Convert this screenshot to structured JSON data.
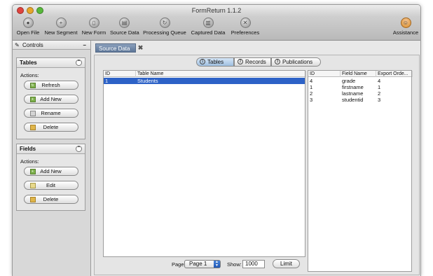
{
  "window": {
    "title": "FormReturn 1.1.2"
  },
  "toolbar": {
    "items": [
      {
        "label": "Open File",
        "icon": "open-file-icon"
      },
      {
        "label": "New Segment",
        "icon": "new-segment-icon"
      },
      {
        "label": "New Form",
        "icon": "new-form-icon"
      },
      {
        "label": "Source Data",
        "icon": "source-data-icon"
      },
      {
        "label": "Processing Queue",
        "icon": "processing-queue-icon"
      },
      {
        "label": "Captured Data",
        "icon": "captured-data-icon"
      },
      {
        "label": "Preferences",
        "icon": "preferences-icon"
      }
    ],
    "assistance_label": "Assistance"
  },
  "sidebar": {
    "controls_label": "Controls",
    "collapse_symbol": "–",
    "tables_panel": {
      "title": "Tables",
      "actions_label": "Actions:",
      "buttons": [
        "Refresh",
        "Add New",
        "Rename",
        "Delete"
      ]
    },
    "fields_panel": {
      "title": "Fields",
      "actions_label": "Actions:",
      "buttons": [
        "Add New",
        "Edit",
        "Delete"
      ]
    }
  },
  "main": {
    "doc_tab": {
      "label": "Source Data"
    },
    "segments": [
      {
        "num": "1",
        "label": "Tables",
        "active": true
      },
      {
        "num": "2",
        "label": "Records",
        "active": false
      },
      {
        "num": "3",
        "label": "Publications",
        "active": false
      }
    ],
    "tables_table": {
      "headers": [
        "ID",
        "Table Name"
      ],
      "rows": [
        {
          "id": "1",
          "name": "Students",
          "selected": true
        }
      ]
    },
    "fields_table": {
      "headers": [
        "ID",
        "Field Name",
        "Export Orde..."
      ],
      "rows": [
        {
          "id": "4",
          "name": "grade",
          "order": "4"
        },
        {
          "id": "1",
          "name": "firstname",
          "order": "1"
        },
        {
          "id": "2",
          "name": "lastname",
          "order": "2"
        },
        {
          "id": "3",
          "name": "studentid",
          "order": "3"
        }
      ]
    },
    "pagination": {
      "page_label": "Page:",
      "page_value": "Page 1",
      "show_label": "Show:",
      "show_value": "1000",
      "limit_label": "Limit"
    }
  },
  "colors": {
    "selection": "#2d62c7",
    "close_red": "#e0443e",
    "minimize_yellow": "#e6a52a",
    "zoom_green": "#58b83b"
  }
}
